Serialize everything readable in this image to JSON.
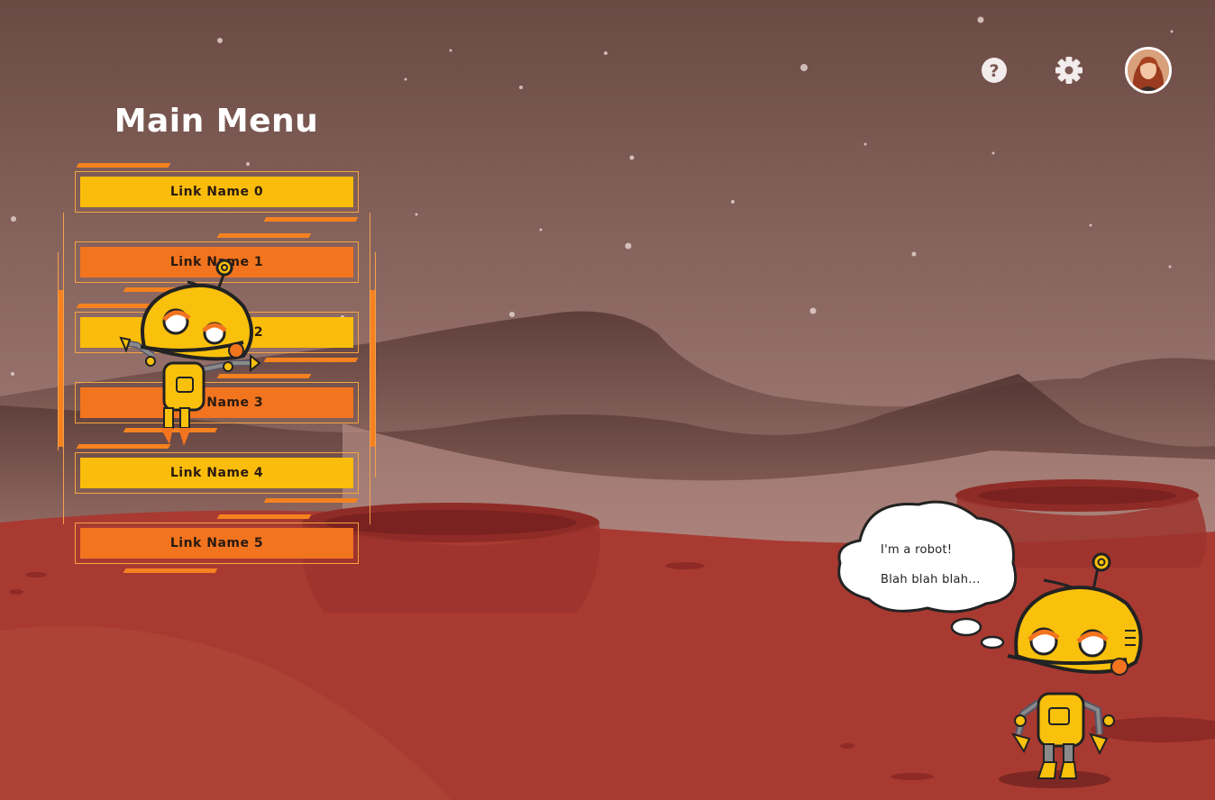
{
  "menu": {
    "title": "Main Menu",
    "links": [
      {
        "label": "Link Name 0",
        "style": "yellow"
      },
      {
        "label": "Link Name 1",
        "style": "orange"
      },
      {
        "label": "Link Name 2",
        "style": "yellow"
      },
      {
        "label": "Link Name 3",
        "style": "orange"
      },
      {
        "label": "Link Name 4",
        "style": "yellow"
      },
      {
        "label": "Link Name 5",
        "style": "orange"
      }
    ]
  },
  "toolbar": {
    "help_icon": "help-circle-icon",
    "settings_icon": "gear-icon",
    "avatar_icon": "user-avatar"
  },
  "speech": {
    "line1": "I'm a robot!",
    "line2": "Blah blah blah..."
  },
  "colors": {
    "button_yellow": "#fbbd0b",
    "button_orange": "#f2741f",
    "accent": "#f5821f",
    "robot_body": "#f9c10b",
    "ground": "#a83a32",
    "sky_top": "#6b4a44"
  }
}
